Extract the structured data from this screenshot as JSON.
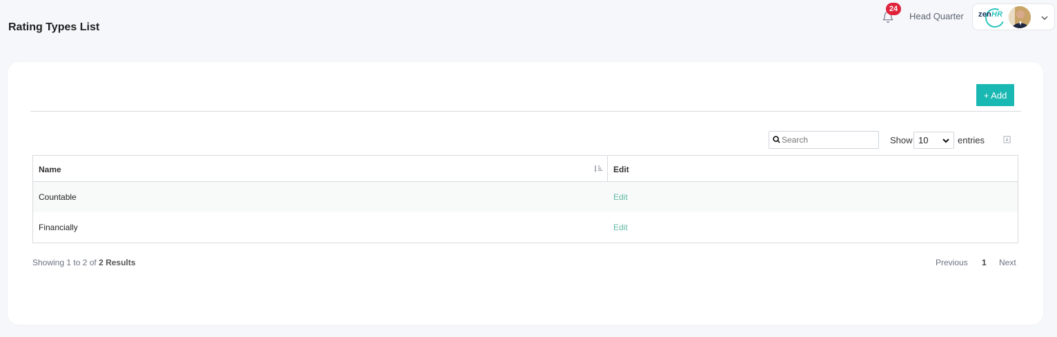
{
  "page": {
    "title": "Rating Types List"
  },
  "header": {
    "notifications_count": "24",
    "org_name": "Head Quarter",
    "logo": {
      "zen": "zen",
      "hr": "HR"
    },
    "colors": {
      "badge": "#e0233a",
      "brand": "#19b8b2"
    }
  },
  "toolbar": {
    "add_label": "+ Add"
  },
  "filters": {
    "search_placeholder": "Search",
    "show_label": "Show",
    "page_size": "10",
    "entries_label": "entries"
  },
  "table": {
    "columns": [
      "Name",
      "Edit"
    ],
    "rows": [
      {
        "name": "Countable",
        "edit": "Edit"
      },
      {
        "name": "Financially",
        "edit": "Edit"
      }
    ]
  },
  "footer": {
    "showing_prefix": "Showing 1 to 2 of",
    "showing_total": "2 Results",
    "pagination": {
      "previous": "Previous",
      "current": "1",
      "next": "Next"
    }
  }
}
